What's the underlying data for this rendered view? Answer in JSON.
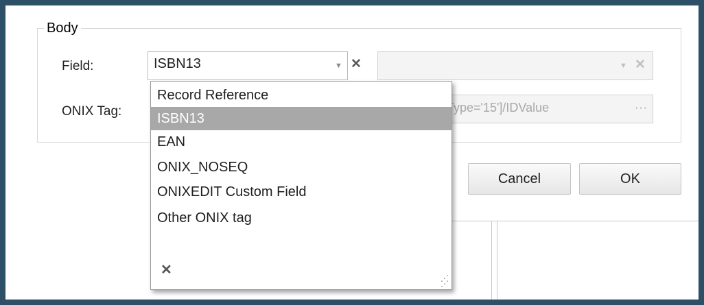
{
  "fieldset": {
    "legend": "Body"
  },
  "field": {
    "label": "Field:",
    "value": "ISBN13",
    "arrow_icon": "chevron-down-icon",
    "clear_icon": "close-icon"
  },
  "secondary_field": {
    "value": ""
  },
  "onix_tag": {
    "label": "ONIX Tag:",
    "value": "Type='15']/IDValue",
    "browse_label": "···"
  },
  "buttons": {
    "cancel": "Cancel",
    "ok": "OK"
  },
  "dropdown": {
    "items": [
      {
        "label": "Record Reference",
        "selected": false
      },
      {
        "label": "ISBN13",
        "selected": true
      },
      {
        "label": "EAN",
        "selected": false
      },
      {
        "label": "ONIX_NOSEQ",
        "selected": false
      },
      {
        "label": "ONIXEDIT Custom Field",
        "selected": false
      },
      {
        "label": "Other ONIX tag",
        "selected": false
      }
    ],
    "close_symbol": "✕",
    "resize_icon": "resize-grip-icon"
  },
  "colors": {
    "selected_bg": "#a8a8a8",
    "frame": "#2e5067"
  }
}
